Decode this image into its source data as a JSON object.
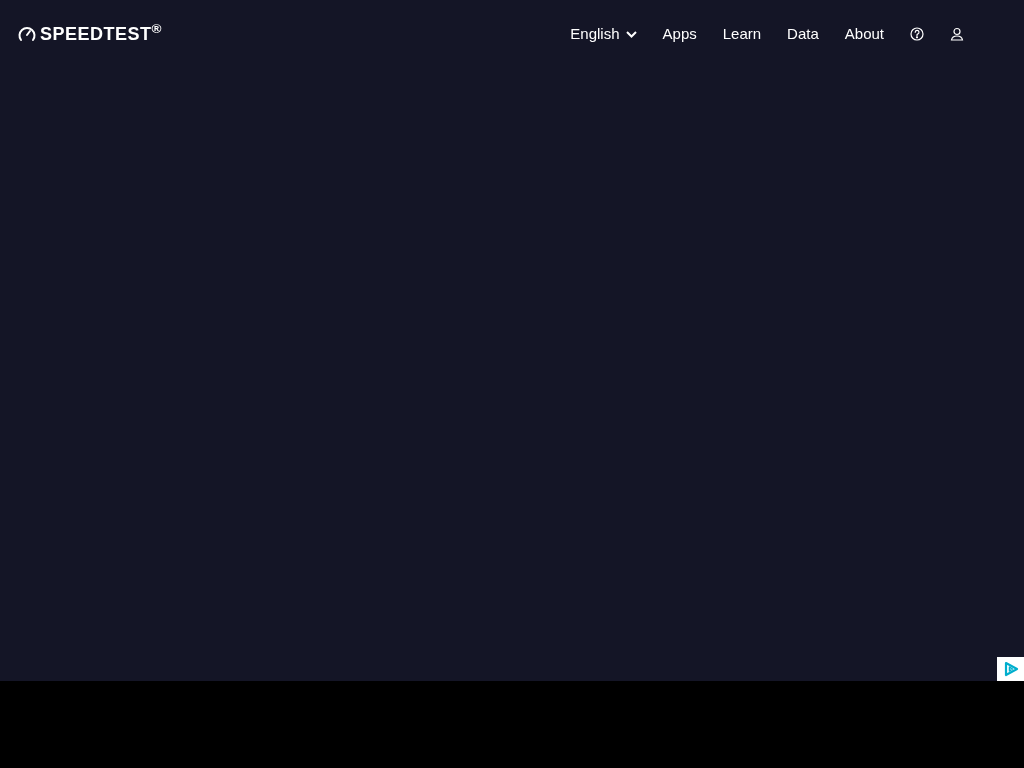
{
  "header": {
    "logo": "SPEEDTEST$^{®}$",
    "nav": [
      {
        "label": "English",
        "kind": "dropdown"
      },
      {
        "label": "Apps",
        "kind": "link"
      },
      {
        "label": "Learn",
        "kind": "link"
      },
      {
        "label": "Data",
        "kind": "link"
      },
      {
        "label": "About",
        "kind": "link"
      }
    ]
  }
}
